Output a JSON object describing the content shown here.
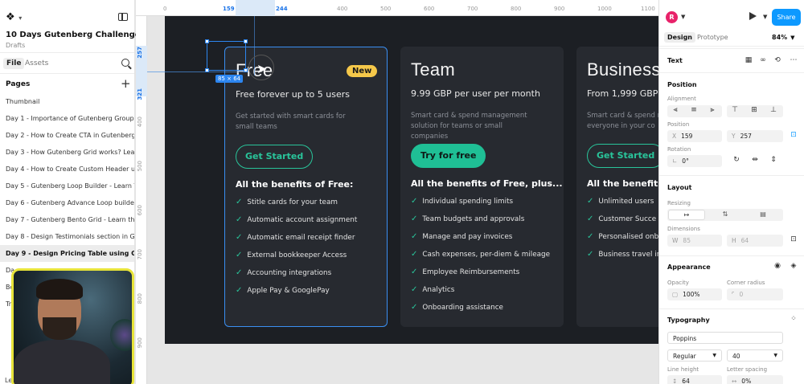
{
  "left_panel": {
    "logo_chevron": "▾",
    "project_title": "10 Days Gutenberg Challenge",
    "project_subtitle": "Drafts",
    "tab_file": "File",
    "tab_assets": "Assets",
    "pages_label": "Pages",
    "pages": [
      "Thumbnail",
      "Day 1 - Importance of Gutenberg Group, R...",
      "Day 2 - How to Create CTA in Gutenberg",
      "Day 3 - How Gutenberg Grid works? Learn ...",
      "Day 4 - How to Create Custom Header usi...",
      "Day 5 - Gutenberg Loop Builder - Learn Th...",
      "Day 6 - Gutenberg Advance Loop builder ...",
      "Day 7 - Gutenberg Bento Grid - Learn the ...",
      "Day 8 - Design Testimonials section in Gut...",
      "Day 9 - Design Pricing Table using Guten...",
      "Da",
      "Bo",
      "Tr"
    ],
    "active_page_index": 9,
    "bottom_text": "Le"
  },
  "rulers": {
    "top": [
      "0",
      "159",
      "244",
      "400",
      "500",
      "600",
      "700",
      "800",
      "900",
      "1000",
      "1100"
    ],
    "left": [
      "257",
      "321",
      "400",
      "500",
      "600",
      "700",
      "800",
      "900"
    ]
  },
  "selection": {
    "dimension_label": "85 × 64"
  },
  "pricing_cards": [
    {
      "name": "Free",
      "badge": "New",
      "price": "Free forever up to 5 users",
      "description": "Get started with smart cards for small teams",
      "cta": "Get Started",
      "cta_style": "outline",
      "benefits_title": "All the benefits of Free:",
      "features": [
        "Stitle cards for your team",
        "Automatic account assignment",
        "Automatic email receipt finder",
        "External bookkeeper Access",
        "Accounting integrations",
        "Apple Pay & GooglePay"
      ]
    },
    {
      "name": "Team",
      "badge": "",
      "price": "9.99 GBP per user per month",
      "description": "Smart card & spend management solution for teams or small companies",
      "cta": "Try for free",
      "cta_style": "solid",
      "benefits_title": "All the benefits of Free, plus...",
      "features": [
        "Individual spending limits",
        "Team budgets and approvals",
        "Manage and pay invoices",
        "Cash expenses, per-diem & mileage",
        "Employee Reimbursements",
        "Analytics",
        "Onboarding assistance"
      ]
    },
    {
      "name": "Business",
      "badge": "",
      "price": "From 1,999 GBP per",
      "description": "Smart card & spend management for everyone in your co",
      "cta": "Get Started",
      "cta_style": "outline",
      "benefits_title": "All the benefits",
      "features": [
        "Unlimited users",
        "Customer Succe",
        "Personalised onb",
        "Business travel in"
      ]
    }
  ],
  "right_panel": {
    "avatar_letter": "R",
    "share_label": "Share",
    "tab_design": "Design",
    "tab_prototype": "Prototype",
    "zoom": "84%",
    "layer_type": "Text",
    "position_title": "Position",
    "alignment_label": "Alignment",
    "position_label": "Position",
    "x_prefix": "X",
    "x_value": "159",
    "y_prefix": "Y",
    "y_value": "257",
    "rotation_label": "Rotation",
    "rotation_value": "0°",
    "layout_title": "Layout",
    "resizing_label": "Resizing",
    "dimensions_label": "Dimensions",
    "w_prefix": "W",
    "w_value": "85",
    "h_prefix": "H",
    "h_value": "64",
    "appearance_title": "Appearance",
    "opacity_label": "Opacity",
    "opacity_value": "100%",
    "corner_label": "Corner radius",
    "corner_value": "0",
    "typography_title": "Typography",
    "font_family": "Poppins",
    "font_weight": "Regular",
    "font_size": "40",
    "line_height_label": "Line height",
    "line_height_value": "64",
    "letter_spacing_label": "Letter spacing",
    "letter_spacing_value": "0%"
  },
  "colors": {
    "accent_blue": "#0d99ff",
    "cta_green": "#1fbf95",
    "badge_yellow": "#f5c84a",
    "frame_bg": "#1c1f24",
    "card_bg": "#272a30"
  }
}
